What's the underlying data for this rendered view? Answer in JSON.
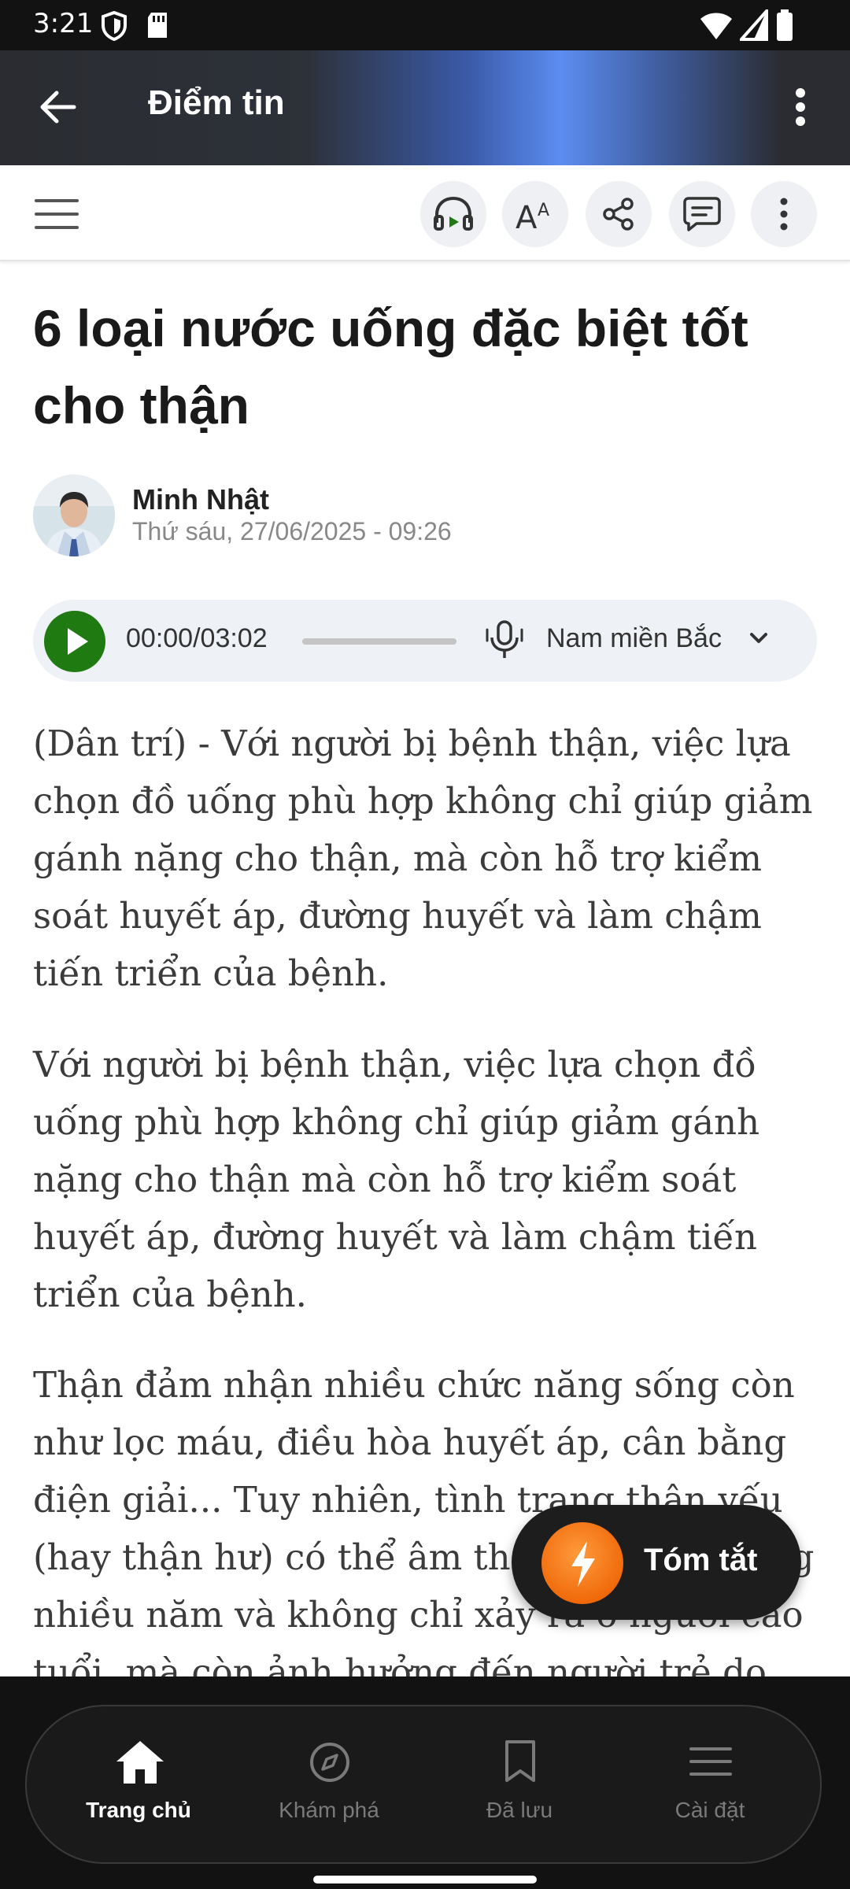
{
  "status_bar": {
    "time": "3:21"
  },
  "app_bar": {
    "title": "Điểm tin"
  },
  "article": {
    "headline": "6 loại nước uống đặc biệt tốt cho thận",
    "author": "Minh Nhật",
    "date": "Thứ sáu, 27/06/2025 - 09:26",
    "audio": {
      "time": "00:00/03:02",
      "progress": 0.0,
      "voice": "Nam miền Bắc"
    },
    "paragraphs": [
      "(Dân trí) - Với người bị bệnh thận, việc lựa chọn đồ uống phù hợp không chỉ giúp giảm gánh nặng cho thận, mà còn hỗ trợ kiểm soát huyết áp, đường huyết và làm chậm tiến triển của bệnh.",
      "Với người bị bệnh thận, việc lựa chọn đồ uống phù hợp không chỉ giúp giảm gánh nặng cho thận mà còn hỗ trợ kiểm soát huyết áp, đường huyết và làm chậm tiến triển của bệnh.",
      "Thận đảm nhận nhiều chức năng sống còn như lọc máu, điều hòa huyết áp, cân bằng điện giải... Tuy nhiên, tình trạng thận yếu (hay thận hư) có thể âm thầm diễn ra trong nhiều năm và không chỉ xảy ra ở người cao tuổi, mà còn ảnh hưởng đến người trẻ do lối"
    ]
  },
  "summary_button": {
    "label": "Tóm tắt"
  },
  "bottom_nav": [
    {
      "label": "Trang chủ",
      "icon": "home-icon",
      "active": true
    },
    {
      "label": "Khám phá",
      "icon": "compass-icon",
      "active": false
    },
    {
      "label": "Đã lưu",
      "icon": "bookmark-icon",
      "active": false
    },
    {
      "label": "Cài đặt",
      "icon": "menu-icon",
      "active": false
    }
  ],
  "colors": {
    "play": "#1f7a12",
    "fab_accent": "#f06a0a",
    "nav_bg": "#121212"
  }
}
